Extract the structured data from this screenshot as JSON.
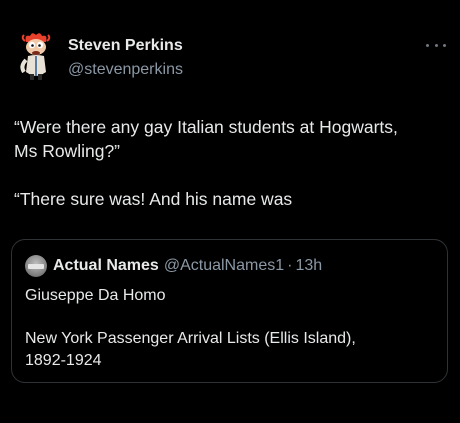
{
  "author": {
    "display_name": "Steven Perkins",
    "handle": "@stevenperkins",
    "avatar_icon": "beaker-muppet-avatar"
  },
  "tweet": {
    "line1": "“Were there any gay Italian students at Hogwarts,",
    "line2": "Ms Rowling?”",
    "line3": "“There sure was! And his name was"
  },
  "quote": {
    "name": "Actual Names",
    "handle": "@ActualNames1",
    "separator": "·",
    "time": "13h",
    "text": "Giuseppe Da Homo",
    "source_line1": "New York Passenger Arrival Lists (Ellis Island),",
    "source_line2": "1892-1924"
  },
  "colors": {
    "background": "#000000",
    "text": "#e7e9ea",
    "secondary_text": "#8b98a5",
    "border": "#2f3336"
  }
}
